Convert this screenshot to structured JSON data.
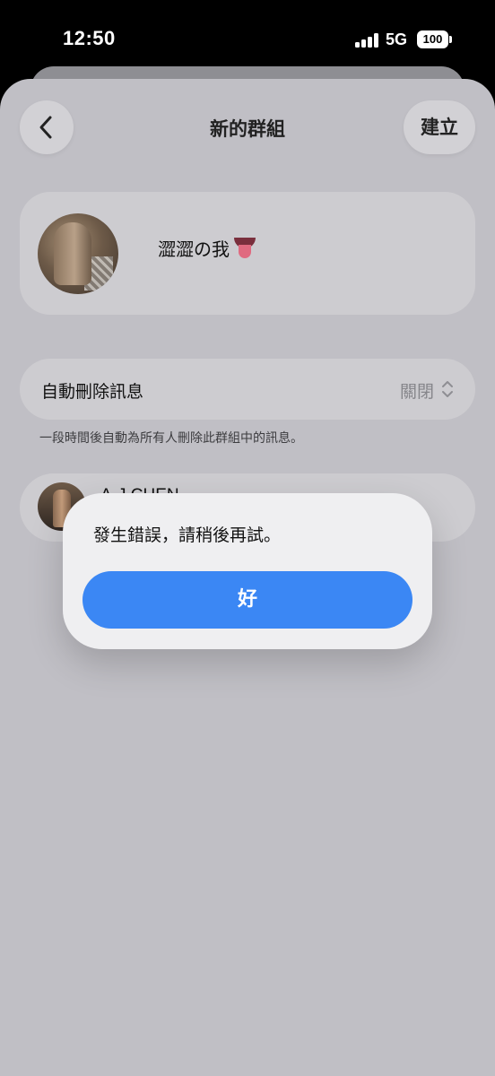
{
  "status_bar": {
    "time": "12:50",
    "network": "5G",
    "battery": "100"
  },
  "header": {
    "title": "新的群組",
    "back_icon": "chevron-left-icon",
    "create_label": "建立"
  },
  "group": {
    "name": "澀澀の我",
    "emoji": "tongue-emoji"
  },
  "settings": {
    "auto_delete_label": "自動刪除訊息",
    "auto_delete_value": "關閉",
    "auto_delete_icon": "chevron-up-down-icon",
    "auto_delete_help": "一段時間後自動為所有人刪除此群組中的訊息。"
  },
  "members": [
    {
      "name": "A-J CHEN"
    }
  ],
  "alert": {
    "message": "發生錯誤，請稍後再試。",
    "ok_label": "好"
  },
  "colors": {
    "accent": "#3b87f4",
    "sheet_background": "#c0bfc5",
    "card_background": "#cdccd0",
    "alert_background": "#efeff1"
  }
}
